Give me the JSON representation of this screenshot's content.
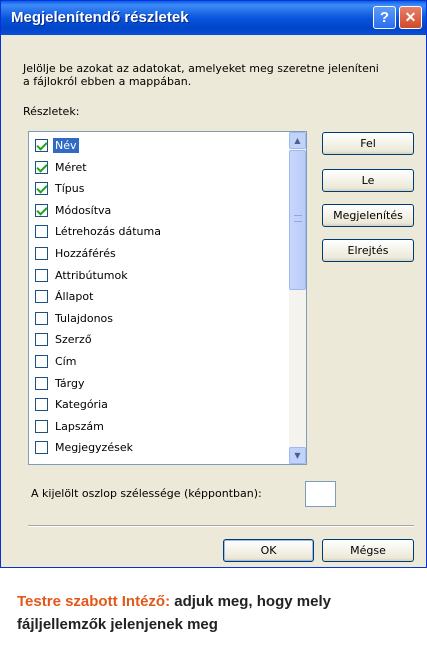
{
  "window": {
    "title": "Megjelenítendő részletek",
    "help_glyph": "?",
    "close_glyph": "✕"
  },
  "description": "Jelölje be azokat az adatokat, amelyeket meg szeretne jeleníteni a fájlokról ebben a mappában.",
  "details_label": "Részletek:",
  "details_list": [
    {
      "label": "Név",
      "checked": true,
      "selected": true
    },
    {
      "label": "Méret",
      "checked": true,
      "selected": false
    },
    {
      "label": "Típus",
      "checked": true,
      "selected": false
    },
    {
      "label": "Módosítva",
      "checked": true,
      "selected": false
    },
    {
      "label": "Létrehozás dátuma",
      "checked": false,
      "selected": false
    },
    {
      "label": "Hozzáférés",
      "checked": false,
      "selected": false
    },
    {
      "label": "Attribútumok",
      "checked": false,
      "selected": false
    },
    {
      "label": "Állapot",
      "checked": false,
      "selected": false
    },
    {
      "label": "Tulajdonos",
      "checked": false,
      "selected": false
    },
    {
      "label": "Szerző",
      "checked": false,
      "selected": false
    },
    {
      "label": "Cím",
      "checked": false,
      "selected": false
    },
    {
      "label": "Tárgy",
      "checked": false,
      "selected": false
    },
    {
      "label": "Kategória",
      "checked": false,
      "selected": false
    },
    {
      "label": "Lapszám",
      "checked": false,
      "selected": false
    },
    {
      "label": "Megjegyzések",
      "checked": false,
      "selected": false
    }
  ],
  "buttons": {
    "up": "Fel",
    "down": "Le",
    "show": "Megjelenítés",
    "hide": "Elrejtés",
    "ok": "OK",
    "cancel": "Mégse"
  },
  "column_width": {
    "label": "A kijelölt oszlop szélessége (képpontban):",
    "value": ""
  },
  "caption": {
    "lead": "Testre szabott Intéző:",
    "text": " adjuk meg, hogy mely fájljellemzők jelenjenek meg"
  },
  "colors": {
    "titlebar": "#0a55dc",
    "selection": "#316ac5",
    "caption_accent": "#e4571a",
    "checkmark": "#21a121"
  }
}
